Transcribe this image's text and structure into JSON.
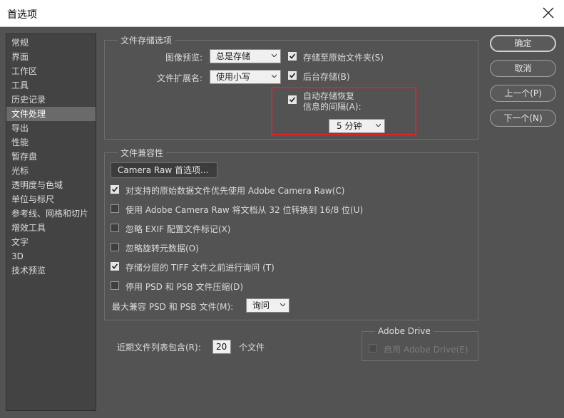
{
  "window": {
    "title": "首选项"
  },
  "sidebar": {
    "items": [
      {
        "label": "常规",
        "selected": false
      },
      {
        "label": "界面",
        "selected": false
      },
      {
        "label": "工作区",
        "selected": false
      },
      {
        "label": "工具",
        "selected": false
      },
      {
        "label": "历史记录",
        "selected": false
      },
      {
        "label": "文件处理",
        "selected": true
      },
      {
        "label": "导出",
        "selected": false
      },
      {
        "label": "性能",
        "selected": false
      },
      {
        "label": "暂存盘",
        "selected": false
      },
      {
        "label": "光标",
        "selected": false
      },
      {
        "label": "透明度与色域",
        "selected": false
      },
      {
        "label": "单位与标尺",
        "selected": false
      },
      {
        "label": "参考线、网格和切片",
        "selected": false
      },
      {
        "label": "增效工具",
        "selected": false
      },
      {
        "label": "文字",
        "selected": false
      },
      {
        "label": "3D",
        "selected": false
      },
      {
        "label": "技术预览",
        "selected": false
      }
    ]
  },
  "file_save": {
    "legend": "文件存储选项",
    "image_preview_label": "图像预览:",
    "image_preview_value": "总是存储",
    "ext_label": "文件扩展名:",
    "ext_value": "使用小写",
    "save_to_original": {
      "label": "存储至原始文件夹(S)",
      "checked": true
    },
    "background_save": {
      "label": "后台存储(B)",
      "checked": true
    },
    "auto_save": {
      "label": "自动存储恢复",
      "checked": true
    },
    "interval_label": "信息的间隔(A):",
    "interval_value": "5 分钟"
  },
  "compat": {
    "legend": "文件兼容性",
    "camera_raw_button": "Camera Raw 首选项...",
    "options": [
      {
        "label": "对支持的原始数据文件优先使用 Adobe Camera Raw(C)",
        "checked": true
      },
      {
        "label": "使用 Adobe Camera Raw 将文档从 32 位转换到 16/8 位(U)",
        "checked": false
      },
      {
        "label": "忽略 EXIF 配置文件标记(X)",
        "checked": false
      },
      {
        "label": "忽略旋转元数据(O)",
        "checked": false
      },
      {
        "label": "存储分层的 TIFF 文件之前进行询问 (T)",
        "checked": true
      },
      {
        "label": "停用 PSD 和 PSB 文件压缩(D)",
        "checked": false
      }
    ],
    "max_compat_label": "最大兼容 PSD 和 PSB 文件(M):",
    "max_compat_value": "询问"
  },
  "recent": {
    "label": "近期文件列表包含(R):",
    "value": "20",
    "suffix": "个文件"
  },
  "drive": {
    "legend": "Adobe Drive",
    "enable_label": "启用 Adobe Drive(E)",
    "checked": false
  },
  "buttons": {
    "ok": "确定",
    "cancel": "取消",
    "prev": "上一个(P)",
    "next": "下一个(N)"
  }
}
